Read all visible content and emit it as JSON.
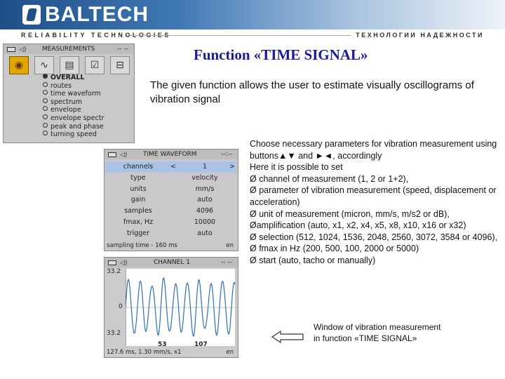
{
  "brand": {
    "logo_text": "BALTECH",
    "tagline_left": "RELIABILITY  TECHNOLOGIES",
    "tagline_right": "ТЕХНОЛОГИИ НАДЕЖНОСТИ"
  },
  "slide": {
    "title": "Function «TIME SIGNAL»",
    "intro": "The given function allows the user to estimate visually oscillograms of vibration signal",
    "description_lines": [
      "Choose necessary parameters for vibration measurement using buttons▲▼ and ►◄, accordingly",
      "Here it is possible to set",
      "Ø  channel of measurement (1, 2 or 1+2),",
      "Ø parameter of vibration measurement (speed, displacement or acceleration)",
      "Ø unit of measurement (micron, mm/s, m/s2 or dB),",
      "Øamplification (auto, x1, x2, x4, x5, x8, x10, x16 or x32)",
      "Ø selection (512, 1024, 1536, 2048, 2560, 3072, 3584 or 4096),",
      "Ø fmax in Hz (200, 500, 100, 2000 or 5000)",
      "Ø start (auto, tacho or manually)"
    ],
    "window_note_line1": "Window of vibration measurement",
    "window_note_line2": "in function «TIME SIGNAL»"
  },
  "measurements_panel": {
    "title": "MEASUREMENTS",
    "dash": "-- --",
    "items": [
      "OVERALL",
      "routes",
      "time waveform",
      "spectrum",
      "envelope",
      "envelope spectr",
      "peak and phase",
      "turning speed"
    ]
  },
  "waveform_panel": {
    "title": "TIME WAVEFORM",
    "dash": "--:--",
    "rows": [
      {
        "key": "channels",
        "value": "1",
        "left": "<",
        "right": ">"
      },
      {
        "key": "type",
        "value": "velocity"
      },
      {
        "key": "units",
        "value": "mm/s"
      },
      {
        "key": "gain",
        "value": "auto"
      },
      {
        "key": "samples",
        "value": "4096"
      },
      {
        "key": "fmax, Hz",
        "value": "10000"
      },
      {
        "key": "trigger",
        "value": "auto"
      }
    ],
    "status": "sampling time - 160 ms",
    "lang": "en"
  },
  "channel_panel": {
    "title": "CHANNEL 1",
    "dash": "-- --",
    "y_top": "33.2",
    "y_mid": "0",
    "y_bottom": "33.2",
    "x_ticks": [
      "53",
      "107"
    ],
    "status": "127.6 ms, 1.30 mm/s, x1",
    "lang": "en"
  },
  "colors": {
    "title_blue": "#1a1aa0",
    "highlight": "#a9c4e4",
    "waveform": "#2e6fb0"
  }
}
